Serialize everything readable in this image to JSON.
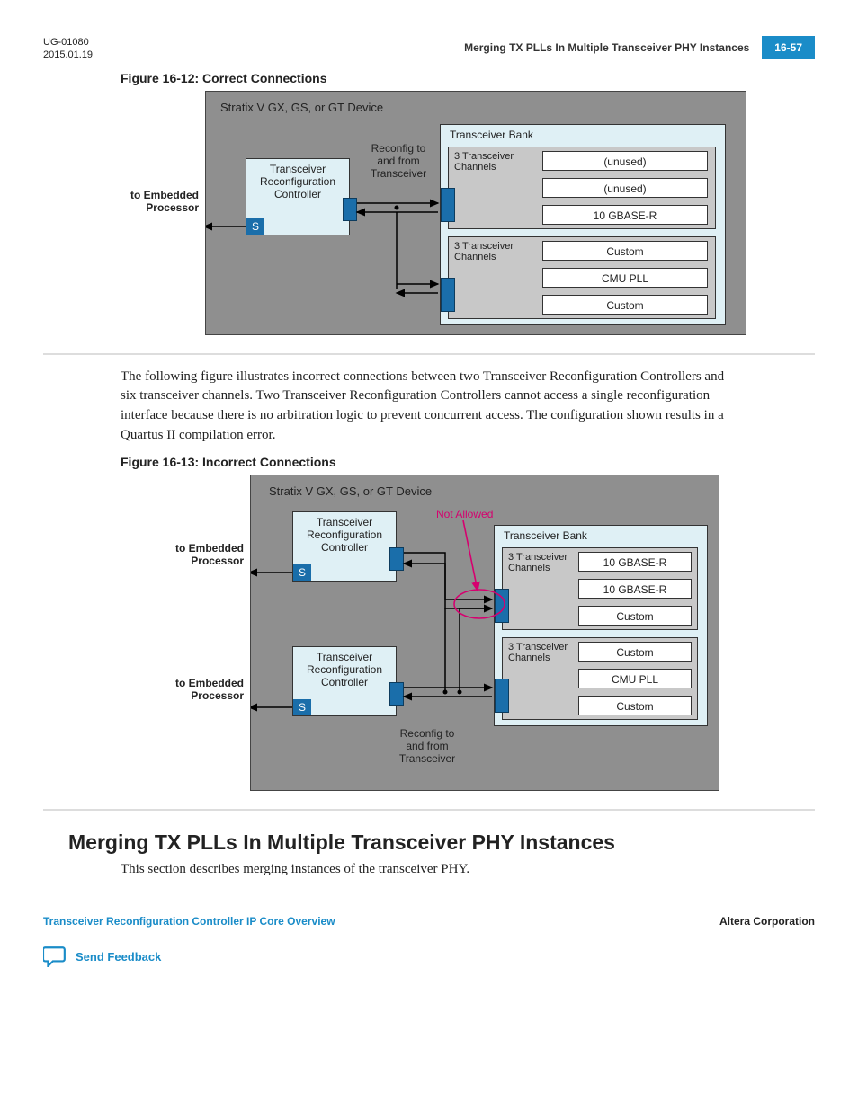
{
  "doc_id": "UG-01080",
  "doc_date": "2015.01.19",
  "header_title": "Merging TX PLLs In Multiple Transceiver PHY Instances",
  "page_number": "16-57",
  "fig12_caption": "Figure 16-12: Correct Connections",
  "fig13_caption": "Figure 16-13: Incorrect Connections",
  "paragraph_between": "The following figure illustrates incorrect connections between two Transceiver Reconfiguration Controllers and six transceiver channels. Two Transceiver Reconfiguration Controllers cannot access a single reconfiguration interface because there is no arbitration logic to prevent concurrent access. The configuration shown results in a Quartus II compilation error.",
  "section_heading": "Merging TX PLLs In Multiple Transceiver PHY Instances",
  "section_body": "This section describes merging instances of the transceiver PHY.",
  "footer_left": "Transceiver Reconfiguration Controller IP Core Overview",
  "footer_right": "Altera Corporation",
  "feedback_label": "Send Feedback",
  "diagram": {
    "device_title": "Stratix V GX, GS, or GT Device",
    "to_proc": "to Embedded\nProcessor",
    "ctrl": "Transceiver\nReconfiguration\nController",
    "s": "S",
    "reconfig": "Reconfig to\nand from\nTransceiver",
    "bank_title": "Transceiver Bank",
    "three_ch": "3 Transceiver\nChannels",
    "not_allowed": "Not Allowed",
    "fig12_slots_top": [
      "(unused)",
      "(unused)",
      "10 GBASE-R"
    ],
    "fig12_slots_bot": [
      "Custom",
      "CMU PLL",
      "Custom"
    ],
    "fig13_slots_top": [
      "10 GBASE-R",
      "10 GBASE-R",
      "Custom"
    ],
    "fig13_slots_bot": [
      "Custom",
      "CMU PLL",
      "Custom"
    ]
  }
}
